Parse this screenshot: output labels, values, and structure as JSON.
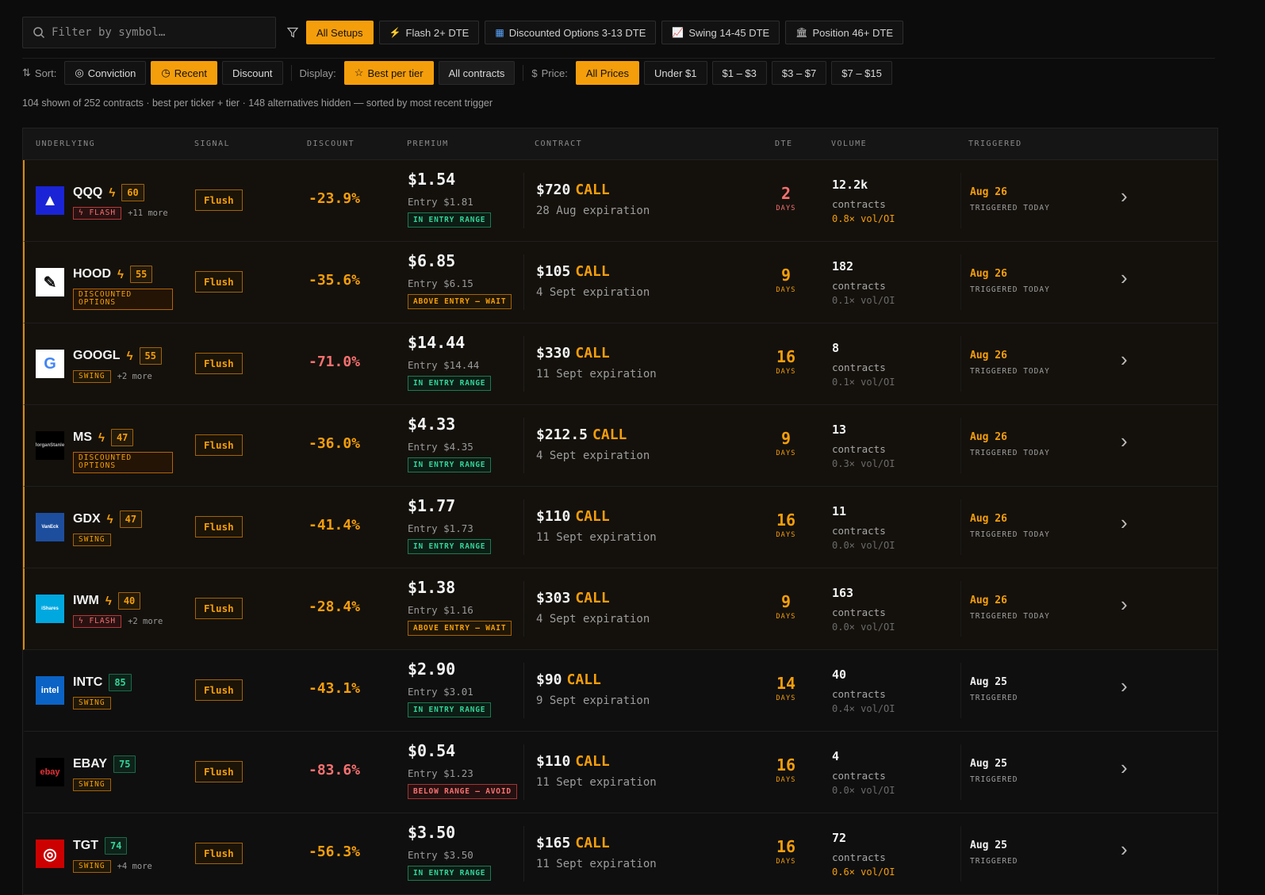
{
  "search": {
    "placeholder": "Filter by symbol…"
  },
  "setups": [
    {
      "label": "All Setups",
      "icon": "",
      "active": true
    },
    {
      "label": "Flash 2+ DTE",
      "icon": "flash-icon",
      "active": false
    },
    {
      "label": "Discounted Options 3-13 DTE",
      "icon": "calendar-icon",
      "active": false
    },
    {
      "label": "Swing 14-45 DTE",
      "icon": "chart-icon",
      "active": false
    },
    {
      "label": "Position 46+ DTE",
      "icon": "bank-icon",
      "active": false
    }
  ],
  "sort": {
    "label": "Sort:",
    "options": [
      "Conviction",
      "Recent",
      "Discount"
    ],
    "active": "Recent"
  },
  "display": {
    "label": "Display:",
    "options": [
      "Best per tier",
      "All contracts"
    ],
    "active": "Best per tier"
  },
  "price": {
    "label": "Price:",
    "options": [
      "All Prices",
      "Under $1",
      "$1 – $3",
      "$3 – $7",
      "$7 – $15"
    ],
    "active": "All Prices"
  },
  "summary": "104 shown of 252 contracts · best per ticker + tier · 148 alternatives hidden — sorted by most recent trigger",
  "columns": [
    "UNDERLYING",
    "SIGNAL",
    "DISCOUNT",
    "PREMIUM",
    "CONTRACT",
    "DTE",
    "VOLUME",
    "TRIGGERED"
  ],
  "colors": {
    "accent": "#f59e0b",
    "red": "#f87171",
    "green": "#34d399"
  },
  "rows": [
    {
      "ticker": "QQQ",
      "bolt": true,
      "score": "60",
      "scoreColor": "or",
      "tag": "FLASH",
      "tagType": "flash",
      "more": "+11 more",
      "signal": "Flush",
      "discount": "-23.9%",
      "discountColor": "#f59e0b",
      "premium": "$1.54",
      "entry": "Entry $1.81",
      "range": "IN ENTRY RANGE",
      "rangeType": "in",
      "strike": "$720",
      "cp": "CALL",
      "expiry": "28 Aug expiration",
      "dte": "2",
      "dteUnit": "DAYS",
      "dteColor": "red",
      "volume": "12.2k",
      "volUnit": "contracts",
      "voi": "0.8× vol/OI",
      "voiType": "hi",
      "triggered": "Aug 26",
      "triggeredSub": "TRIGGERED TODAY",
      "trigColor": "or",
      "hot": true,
      "logo": {
        "bg": "#1a24d6",
        "fg": "#ffffff",
        "text": "▲"
      }
    },
    {
      "ticker": "HOOD",
      "bolt": true,
      "score": "55",
      "scoreColor": "or",
      "tag": "DISCOUNTED OPTIONS",
      "tagType": "disc",
      "more": "",
      "signal": "Flush",
      "discount": "-35.6%",
      "discountColor": "#f59e0b",
      "premium": "$6.85",
      "entry": "Entry $6.15",
      "range": "ABOVE ENTRY — WAIT",
      "rangeType": "above",
      "strike": "$105",
      "cp": "CALL",
      "expiry": "4 Sept expiration",
      "dte": "9",
      "dteUnit": "DAYS",
      "dteColor": "or",
      "volume": "182",
      "volUnit": "contracts",
      "voi": "0.1× vol/OI",
      "voiType": "lo",
      "triggered": "Aug 26",
      "triggeredSub": "TRIGGERED TODAY",
      "trigColor": "or",
      "hot": true,
      "logo": {
        "bg": "#ffffff",
        "fg": "#111111",
        "text": "✎"
      }
    },
    {
      "ticker": "GOOGL",
      "bolt": true,
      "score": "55",
      "scoreColor": "or",
      "tag": "SWING",
      "tagType": "swing",
      "more": "+2 more",
      "signal": "Flush",
      "discount": "-71.0%",
      "discountColor": "#f87171",
      "premium": "$14.44",
      "entry": "Entry $14.44",
      "range": "IN ENTRY RANGE",
      "rangeType": "in",
      "strike": "$330",
      "cp": "CALL",
      "expiry": "11 Sept expiration",
      "dte": "16",
      "dteUnit": "DAYS",
      "dteColor": "or",
      "volume": "8",
      "volUnit": "contracts",
      "voi": "0.1× vol/OI",
      "voiType": "lo",
      "triggered": "Aug 26",
      "triggeredSub": "TRIGGERED TODAY",
      "trigColor": "or",
      "hot": true,
      "logo": {
        "bg": "#ffffff",
        "fg": "#4285f4",
        "text": "G"
      }
    },
    {
      "ticker": "MS",
      "bolt": true,
      "score": "47",
      "scoreColor": "or",
      "tag": "DISCOUNTED OPTIONS",
      "tagType": "disc",
      "more": "",
      "signal": "Flush",
      "discount": "-36.0%",
      "discountColor": "#f59e0b",
      "premium": "$4.33",
      "entry": "Entry $4.35",
      "range": "IN ENTRY RANGE",
      "rangeType": "in",
      "strike": "$212.5",
      "cp": "CALL",
      "expiry": "4 Sept expiration",
      "dte": "9",
      "dteUnit": "DAYS",
      "dteColor": "or",
      "volume": "13",
      "volUnit": "contracts",
      "voi": "0.3× vol/OI",
      "voiType": "lo",
      "triggered": "Aug 26",
      "triggeredSub": "TRIGGERED TODAY",
      "trigColor": "or",
      "hot": true,
      "logo": {
        "bg": "#000000",
        "fg": "#bbbbbb",
        "text": "MorganStanley"
      }
    },
    {
      "ticker": "GDX",
      "bolt": true,
      "score": "47",
      "scoreColor": "or",
      "tag": "SWING",
      "tagType": "swing",
      "more": "",
      "signal": "Flush",
      "discount": "-41.4%",
      "discountColor": "#f59e0b",
      "premium": "$1.77",
      "entry": "Entry $1.73",
      "range": "IN ENTRY RANGE",
      "rangeType": "in",
      "strike": "$110",
      "cp": "CALL",
      "expiry": "11 Sept expiration",
      "dte": "16",
      "dteUnit": "DAYS",
      "dteColor": "or",
      "volume": "11",
      "volUnit": "contracts",
      "voi": "0.0× vol/OI",
      "voiType": "lo",
      "triggered": "Aug 26",
      "triggeredSub": "TRIGGERED TODAY",
      "trigColor": "or",
      "hot": true,
      "logo": {
        "bg": "#1d4e9e",
        "fg": "#ffffff",
        "text": "VanEck"
      }
    },
    {
      "ticker": "IWM",
      "bolt": true,
      "score": "40",
      "scoreColor": "or",
      "tag": "FLASH",
      "tagType": "flash",
      "more": "+2 more",
      "signal": "Flush",
      "discount": "-28.4%",
      "discountColor": "#f59e0b",
      "premium": "$1.38",
      "entry": "Entry $1.16",
      "range": "ABOVE ENTRY — WAIT",
      "rangeType": "above",
      "strike": "$303",
      "cp": "CALL",
      "expiry": "4 Sept expiration",
      "dte": "9",
      "dteUnit": "DAYS",
      "dteColor": "or",
      "volume": "163",
      "volUnit": "contracts",
      "voi": "0.0× vol/OI",
      "voiType": "lo",
      "triggered": "Aug 26",
      "triggeredSub": "TRIGGERED TODAY",
      "trigColor": "or",
      "hot": true,
      "logo": {
        "bg": "#00a8e0",
        "fg": "#ffffff",
        "text": "iShares"
      }
    },
    {
      "ticker": "INTC",
      "bolt": false,
      "score": "85",
      "scoreColor": "gr",
      "tag": "SWING",
      "tagType": "swing",
      "more": "",
      "signal": "Flush",
      "discount": "-43.1%",
      "discountColor": "#f59e0b",
      "premium": "$2.90",
      "entry": "Entry $3.01",
      "range": "IN ENTRY RANGE",
      "rangeType": "in",
      "strike": "$90",
      "cp": "CALL",
      "expiry": "9 Sept expiration",
      "dte": "14",
      "dteUnit": "DAYS",
      "dteColor": "or",
      "volume": "40",
      "volUnit": "contracts",
      "voi": "0.4× vol/OI",
      "voiType": "lo",
      "triggered": "Aug 25",
      "triggeredSub": "TRIGGERED",
      "trigColor": "wh",
      "hot": false,
      "logo": {
        "bg": "#0b63c5",
        "fg": "#ffffff",
        "text": "intel"
      }
    },
    {
      "ticker": "EBAY",
      "bolt": false,
      "score": "75",
      "scoreColor": "gr",
      "tag": "SWING",
      "tagType": "swing",
      "more": "",
      "signal": "Flush",
      "discount": "-83.6%",
      "discountColor": "#f87171",
      "premium": "$0.54",
      "entry": "Entry $1.23",
      "range": "BELOW RANGE — AVOID",
      "rangeType": "below",
      "strike": "$110",
      "cp": "CALL",
      "expiry": "11 Sept expiration",
      "dte": "16",
      "dteUnit": "DAYS",
      "dteColor": "or",
      "volume": "4",
      "volUnit": "contracts",
      "voi": "0.0× vol/OI",
      "voiType": "lo",
      "triggered": "Aug 25",
      "triggeredSub": "TRIGGERED",
      "trigColor": "wh",
      "hot": false,
      "logo": {
        "bg": "#000000",
        "fg": "#e53238",
        "text": "ebay"
      }
    },
    {
      "ticker": "TGT",
      "bolt": false,
      "score": "74",
      "scoreColor": "gr",
      "tag": "SWING",
      "tagType": "swing",
      "more": "+4 more",
      "signal": "Flush",
      "discount": "-56.3%",
      "discountColor": "#f59e0b",
      "premium": "$3.50",
      "entry": "Entry $3.50",
      "range": "IN ENTRY RANGE",
      "rangeType": "in",
      "strike": "$165",
      "cp": "CALL",
      "expiry": "11 Sept expiration",
      "dte": "16",
      "dteUnit": "DAYS",
      "dteColor": "or",
      "volume": "72",
      "volUnit": "contracts",
      "voi": "0.6× vol/OI",
      "voiType": "hi",
      "triggered": "Aug 25",
      "triggeredSub": "TRIGGERED",
      "trigColor": "wh",
      "hot": false,
      "logo": {
        "bg": "#cc0000",
        "fg": "#ffffff",
        "text": "◎"
      }
    }
  ]
}
